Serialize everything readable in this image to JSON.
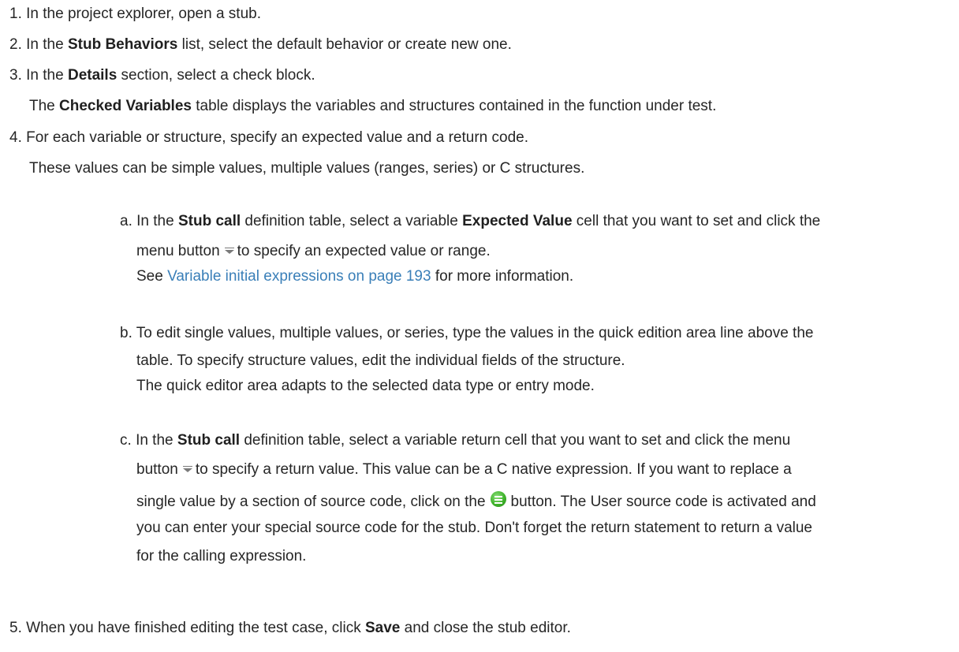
{
  "steps": [
    {
      "num": "1.",
      "text": "In the project explorer, open a stub."
    },
    {
      "num": "2.",
      "pre": "In the ",
      "bold1": "Stub Behaviors",
      "post": " list, select the default behavior or create new one."
    },
    {
      "num": "3.",
      "pre": "In the ",
      "bold1": "Details",
      "post": " section, select a check block.",
      "note_bold": "Checked Variables",
      "note_pre": "The ",
      "note_post": " table displays the variables and structures contained in the function under test."
    },
    {
      "num": "4.",
      "text": "For each variable or structure, specify an expected value and a return code.",
      "note": "These values can be simple values, multiple values (ranges, series) or C structures."
    },
    {
      "num": "5.",
      "pre": "When you have finished editing the test case, click ",
      "bold1": "Save",
      "post": " and close the stub editor."
    }
  ],
  "substeps": {
    "a": {
      "label": "a.",
      "l1_pre": "In the ",
      "l1_bold1": "Stub call",
      "l1_mid": " definition table, select a variable ",
      "l1_bold2": "Expected Value",
      "l1_post": " cell that you want to set and click the",
      "l2_pre": "menu button",
      "l2_post": "to specify an expected value or range.",
      "l3_pre": "See ",
      "l3_link": "Variable initial expressions on page 193",
      "l3_post": " for more information."
    },
    "b": {
      "label": "b.",
      "l1": "To edit single values, multiple values, or series, type the values in the quick edition area line above the",
      "l2": "table. To specify structure values, edit the individual fields of the structure.",
      "l3": "The quick editor area adapts to the selected data type or entry mode."
    },
    "c": {
      "label": "c.",
      "l1_pre": "In the ",
      "l1_bold": "Stub call",
      "l1_post": " definition table, select a variable return cell that you want to set and click the menu",
      "l2_pre": "button",
      "l2_post": "to specify a return value. This value can be a C native expression. If you want to replace a",
      "l3_pre": "single value by a section of source code, click on the",
      "l3_post": "button. The User source code is activated and",
      "l4": "you can enter your special source code for the stub. Don't forget the return statement to return a value",
      "l5": "for the calling expression."
    }
  },
  "icons": {
    "menu": "menu-dropdown-icon",
    "green": "green-stack-icon"
  },
  "colors": {
    "link": "#3a7fb8",
    "icon_green": "#3fb32b"
  }
}
